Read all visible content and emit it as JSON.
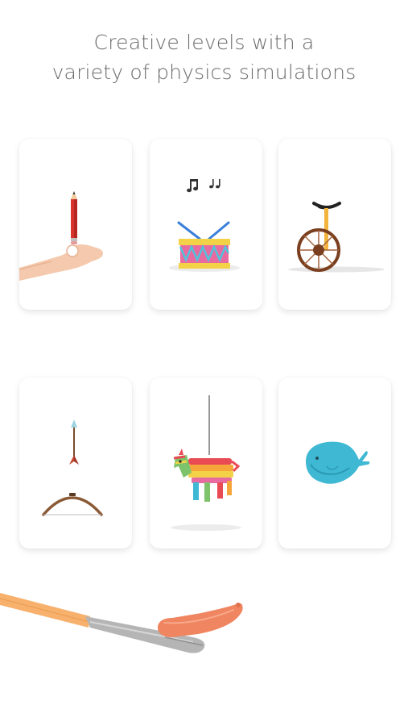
{
  "header": {
    "line1": "Creative levels with a",
    "line2": "variety of physics simulations"
  },
  "levels": [
    {
      "name": "pencil-balance",
      "icon": "pencil-on-hand-icon"
    },
    {
      "name": "drum",
      "icon": "drum-icon"
    },
    {
      "name": "unicycle",
      "icon": "unicycle-icon"
    },
    {
      "name": "bow-and-arrow",
      "icon": "bow-arrow-icon"
    },
    {
      "name": "pinata",
      "icon": "pinata-icon"
    },
    {
      "name": "whale",
      "icon": "whale-icon"
    }
  ],
  "colors": {
    "headline": "#6b6b6b",
    "card_bg": "#ffffff",
    "pencil_red": "#d7332c",
    "drum_yellow": "#f4d247",
    "drum_pink": "#e76ba0",
    "wheel_brown": "#7a3f1f",
    "whale_teal": "#3fb8d3",
    "sausage": "#f08561"
  }
}
